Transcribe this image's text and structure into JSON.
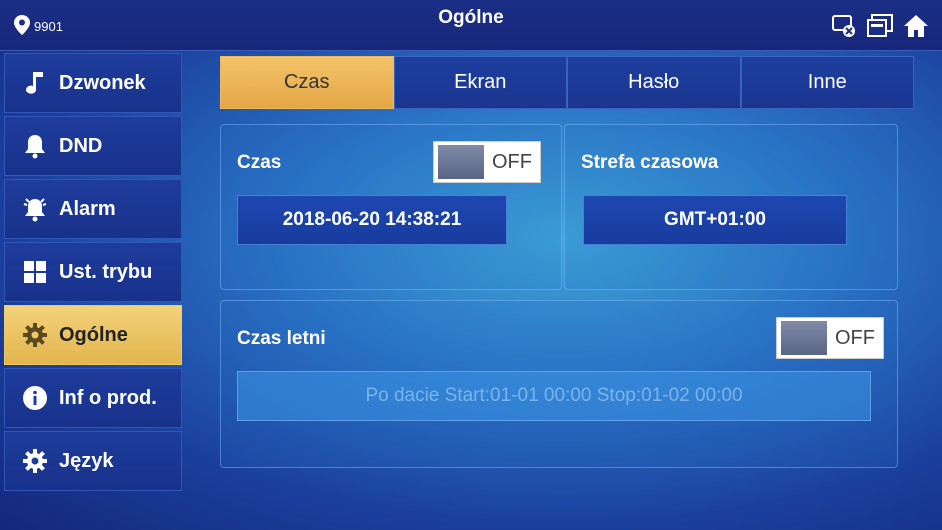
{
  "header": {
    "location_code": "9901",
    "title": "Ogólne"
  },
  "top_icons": [
    "network-status-icon",
    "device-icon",
    "home-icon"
  ],
  "sidebar": {
    "items": [
      {
        "label": "Dzwonek",
        "icon": "music-note-icon"
      },
      {
        "label": "DND",
        "icon": "bell-mute-icon"
      },
      {
        "label": "Alarm",
        "icon": "alarm-bell-icon"
      },
      {
        "label": "Ust. trybu",
        "icon": "grid-icon"
      },
      {
        "label": "Ogólne",
        "icon": "gear-icon",
        "active": true
      },
      {
        "label": "Inf o prod.",
        "icon": "info-icon"
      },
      {
        "label": "Język",
        "icon": "gear-icon"
      }
    ]
  },
  "tabs": [
    {
      "label": "Czas",
      "active": true
    },
    {
      "label": "Ekran"
    },
    {
      "label": "Hasło"
    },
    {
      "label": "Inne"
    }
  ],
  "time_panel": {
    "label": "Czas",
    "toggle": "OFF",
    "datetime": "2018-06-20 14:38:21"
  },
  "timezone_panel": {
    "label": "Strefa czasowa",
    "value": "GMT+01:00"
  },
  "dst_panel": {
    "label": "Czas letni",
    "toggle": "OFF",
    "range": "Po dacie Start:01-01 00:00  Stop:01-02 00:00"
  },
  "colors": {
    "accent_active": "#e8b24f",
    "background": "#2a73c4",
    "topbar": "#17277a"
  }
}
